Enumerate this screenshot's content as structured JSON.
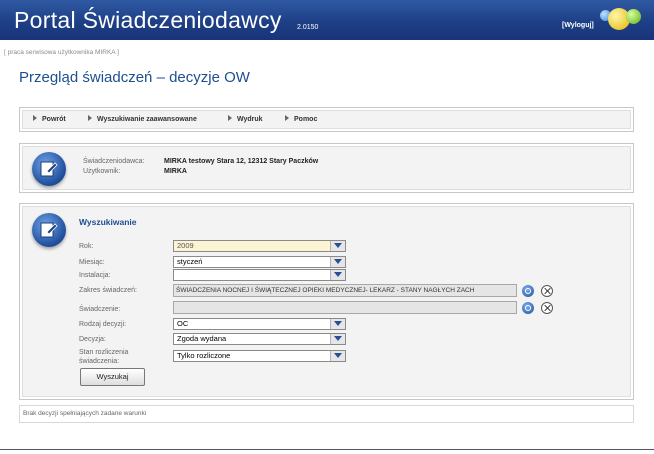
{
  "header": {
    "title": "Portal Świadczeniodawcy",
    "version": "2.0150",
    "logout_label": "[Wyloguj]"
  },
  "service_note": "[ praca serwisowa użytkownika MIRKA ]",
  "page_title": "Przegląd świadczeń – decyzje OW",
  "nav": {
    "items": [
      {
        "label": "Powrót"
      },
      {
        "label": "Wyszukiwanie zaawansowane"
      },
      {
        "label": "Wydruk"
      },
      {
        "label": "Pomoc"
      }
    ]
  },
  "info": {
    "provider_label": "Świadczeniodawca:",
    "provider_value": "MIRKA testowy Stara 12, 12312 Stary Paczków",
    "user_label": "Użytkownik:",
    "user_value": "MIRKA"
  },
  "search": {
    "title": "Wyszukiwanie",
    "fields": {
      "year": {
        "label": "Rok:",
        "value": "2009"
      },
      "month": {
        "label": "Miesiąc:",
        "value": "styczeń"
      },
      "installation": {
        "label": "Instalacja:",
        "value": ""
      },
      "scope": {
        "label": "Zakres świadczeń:",
        "value": "ŚWIADCZENIA NOCNEJ I ŚWIĄTECZNEJ OPIEKI MEDYCZNEJ- LEKARZ - STANY NAGŁYCH ZACH"
      },
      "service": {
        "label": "Świadczenie:",
        "value": ""
      },
      "decision_type": {
        "label": "Rodzaj decyzji:",
        "value": "OC"
      },
      "decision": {
        "label": "Decyzja:",
        "value": "Zgoda wydana"
      },
      "settlement_status": {
        "label": "Stan rozliczenia świadczenia:",
        "value": "Tylko rozliczone"
      }
    },
    "submit_label": "Wyszukaj"
  },
  "result_message": "Brak decyzji spełniających zadane warunki",
  "colors": {
    "header_blue": "#1e3f86",
    "title_blue": "#1d4f91",
    "year_field_bg": "#fdf4d3"
  }
}
